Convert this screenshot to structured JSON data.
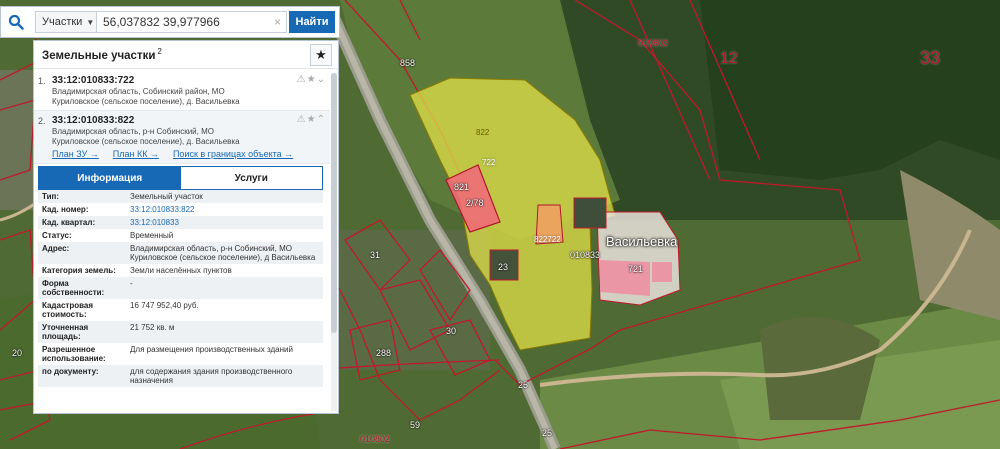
{
  "search": {
    "type_label": "Участки",
    "query": "56,037832 39,977966",
    "clear_icon": "×",
    "find_label": "Найти"
  },
  "panel": {
    "title": "Земельные участки",
    "count": "2",
    "results": [
      {
        "index": "1.",
        "cad_number": "33:12:010833:722",
        "address_line1": "Владимирская область, Собинский район, МО",
        "address_line2": "Куриловское (сельское поселение), д. Васильевка"
      },
      {
        "index": "2.",
        "cad_number": "33:12:010833:822",
        "address_line1": "Владимирская область, р-н Собинский, МО",
        "address_line2": "Куриловское (сельское поселение), д. Васильевка",
        "links": [
          "План ЗУ →",
          "План КК →",
          "Поиск в границах объекта →"
        ]
      }
    ],
    "tabs": {
      "info": "Информация",
      "services": "Услуги"
    },
    "info_rows": [
      {
        "k": "Тип:",
        "v": "Земельный участок"
      },
      {
        "k": "Кад. номер:",
        "v": "33:12:010833:822"
      },
      {
        "k": "Кад. квартал:",
        "v": "33:12:010833"
      },
      {
        "k": "Статус:",
        "v": "Временный"
      },
      {
        "k": "Адрес:",
        "v": "Владимирская область, р-н Собинский, МО Куриловское (сельское поселение), д Васильевка"
      },
      {
        "k": "Категория земель:",
        "v": "Земли населённых пунктов"
      },
      {
        "k": "Форма собственности:",
        "v": "-"
      },
      {
        "k": "Кадастровая стоимость:",
        "v": "16 747 952,40 руб."
      },
      {
        "k": "Уточненная площадь:",
        "v": "21 752 кв. м"
      },
      {
        "k": "Разрешенное использование:",
        "v": "Для размещения производственных зданий"
      },
      {
        "k": "по документу:",
        "v": "для содержания здания производственного назначения"
      }
    ]
  },
  "map": {
    "labels": {
      "l858": "858",
      "l010802_top": "010802",
      "l12": "12",
      "l33": "33",
      "l822": "822",
      "l722": "722",
      "l821": "821",
      "l2_78": "2/78",
      "l822722": "822722",
      "l010833": "010833",
      "town": "Васильевка",
      "l721": "721",
      "l23": "23",
      "l31": "31",
      "l30": "30",
      "l288": "288",
      "l20": "20",
      "l59": "59",
      "l25a": "25",
      "l25b": "25",
      "l010802_bottom": "010802"
    }
  },
  "colors": {
    "accent": "#1769b6",
    "parcel_fill": "#e6e44a",
    "building_fill": "#f06b78",
    "boundary": "#c0192c"
  }
}
